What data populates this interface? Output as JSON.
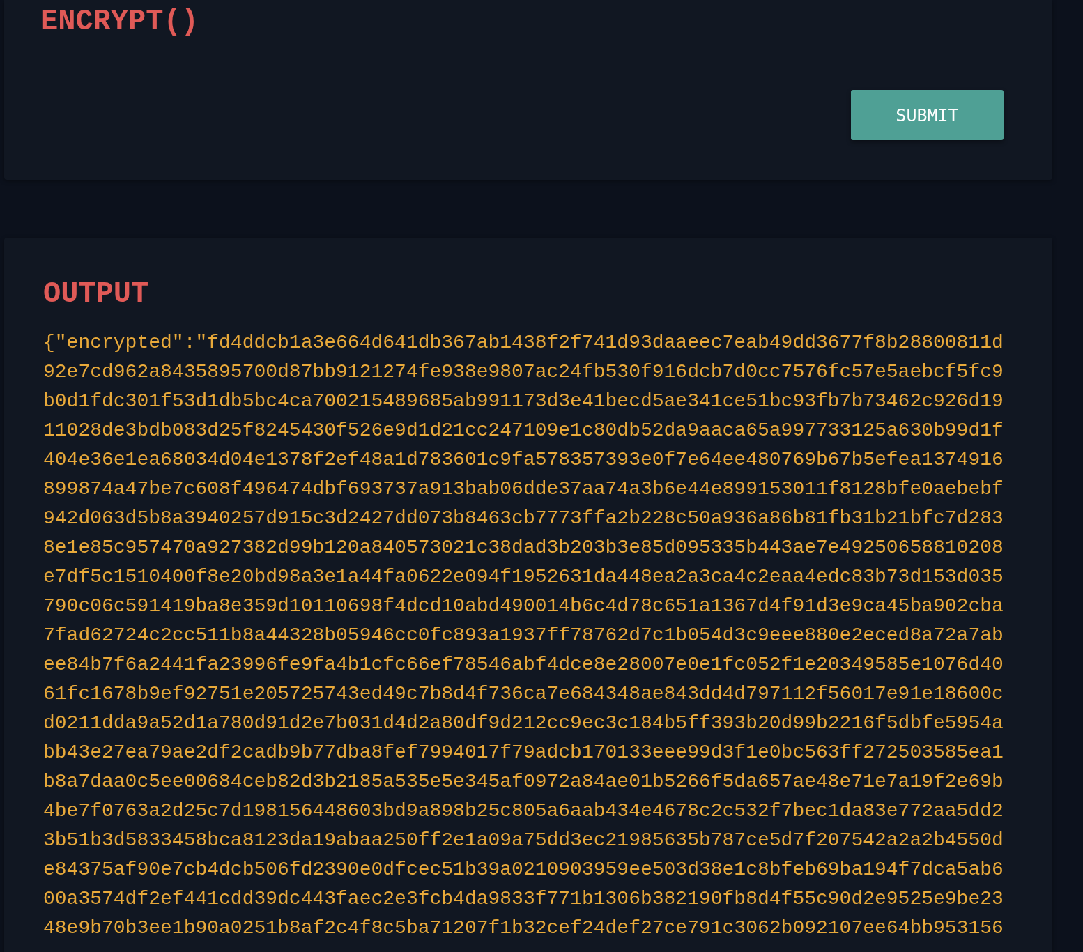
{
  "encrypt_panel": {
    "title": "ENCRYPT()",
    "submit_button": "SUBMIT"
  },
  "output_panel": {
    "title": "OUTPUT",
    "lines": [
      "{\"encrypted\":\"fd4ddcb1a3e664d641db367ab1438f2f741d93daaeec7eab49dd3677f8b28800811d",
      "92e7cd962a8435895700d87bb9121274fe938e9807ac24fb530f916dcb7d0cc7576fc57e5aebcf5fc9",
      "b0d1fdc301f53d1db5bc4ca700215489685ab991173d3e41becd5ae341ce51bc93fb7b73462c926d19",
      "11028de3bdb083d25f8245430f526e9d1d21cc247109e1c80db52da9aaca65a997733125a630b99d1f",
      "404e36e1ea68034d04e1378f2ef48a1d783601c9fa578357393e0f7e64ee480769b67b5efea1374916",
      "899874a47be7c608f496474dbf693737a913bab06dde37aa74a3b6e44e899153011f8128bfe0aebebf",
      "942d063d5b8a3940257d915c3d2427dd073b8463cb7773ffa2b228c50a936a86b81fb31b21bfc7d283",
      "8e1e85c957470a927382d99b120a840573021c38dad3b203b3e85d095335b443ae7e49250658810208",
      "e7df5c1510400f8e20bd98a3e1a44fa0622e094f1952631da448ea2a3ca4c2eaa4edc83b73d153d035",
      "790c06c591419ba8e359d10110698f4dcd10abd490014b6c4d78c651a1367d4f91d3e9ca45ba902cba",
      "7fad62724c2cc511b8a44328b05946cc0fc893a1937ff78762d7c1b054d3c9eee880e2eced8a72a7ab",
      "ee84b7f6a2441fa23996fe9fa4b1cfc66ef78546abf4dce8e28007e0e1fc052f1e20349585e1076d40",
      "61fc1678b9ef92751e205725743ed49c7b8d4f736ca7e684348ae843dd4d797112f56017e91e18600c",
      "d0211dda9a52d1a780d91d2e7b031d4d2a80df9d212cc9ec3c184b5ff393b20d99b2216f5dbfe5954a",
      "bb43e27ea79ae2df2cadb9b77dba8fef7994017f79adcb170133eee99d3f1e0bc563ff272503585ea1",
      "b8a7daa0c5ee00684ceb82d3b2185a535e5e345af0972a84ae01b5266f5da657ae48e71e7a19f2e69b",
      "4be7f0763a2d25c7d198156448603bd9a898b25c805a6aab434e4678c2c532f7bec1da83e772aa5dd2",
      "3b51b3d5833458bca8123da19abaa250ff2e1a09a75dd3ec21985635b787ce5d7f207542a2a2b4550d",
      "e84375af90e7cb4dcb506fd2390e0dfcec51b39a0210903959ee503d38e1c8bfeb69ba194f7dca5ab6",
      "00a3574df2ef441cdd39dc443faec2e3fcb4da9833f771b1306b382190fb8d4f55c90d2e9525e9be23",
      "48e9b70b3ee1b90a0251b8af2c4f8c5ba71207f1b32cef24def27ce791c3062b092107ee64bb953156"
    ]
  }
}
